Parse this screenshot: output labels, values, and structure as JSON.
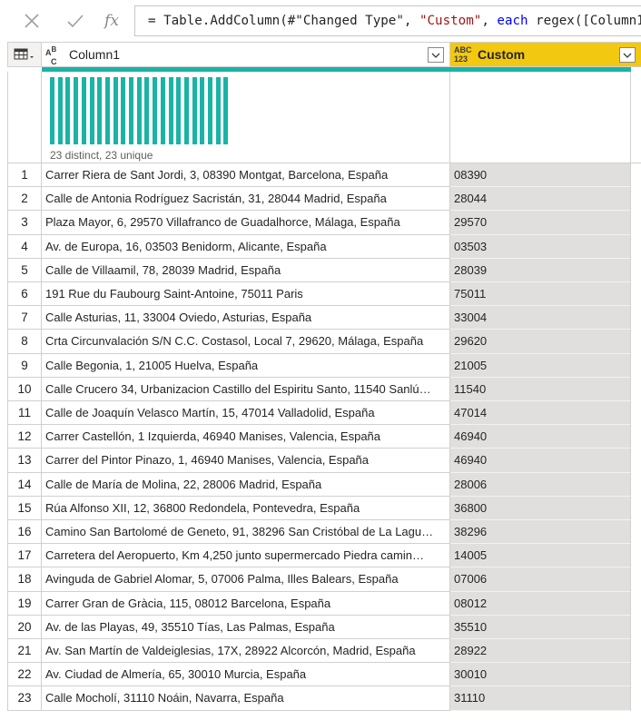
{
  "formula": {
    "cancel_icon": "close-icon",
    "accept_icon": "check-icon",
    "fx_label": "fx",
    "prefix": "= Table.AddColumn(#\"Changed Type\", ",
    "str_custom": "\"Custom\"",
    "sep": ", ",
    "kw_each": "each",
    "suffix": " regex([Column1]) "
  },
  "colors": {
    "accent_column": "#f2c811",
    "quality_bar": "#1ab3a6",
    "selected_cell": "#e1dfdd"
  },
  "columns": [
    {
      "type_top": "A",
      "type_sub": "B",
      "type_bottom": "C",
      "name": "Column1"
    },
    {
      "type_top": "ABC",
      "type_bottom": "123",
      "name": "Custom"
    }
  ],
  "profile": {
    "distinct_unique": "23 distinct, 23 unique",
    "bar_count": 23
  },
  "rows": [
    {
      "n": "1",
      "address": "Carrer Riera de Sant Jordi, 3, 08390 Montgat, Barcelona, España",
      "custom": "08390"
    },
    {
      "n": "2",
      "address": "Calle de Antonia Rodríguez Sacristán, 31, 28044 Madrid, España",
      "custom": "28044"
    },
    {
      "n": "3",
      "address": "Plaza Mayor, 6, 29570 Villafranco de Guadalhorce, Málaga, España",
      "custom": "29570"
    },
    {
      "n": "4",
      "address": "Av. de Europa, 16, 03503 Benidorm, Alicante, España",
      "custom": "03503"
    },
    {
      "n": "5",
      "address": "Calle de Villaamil, 78, 28039 Madrid, España",
      "custom": "28039"
    },
    {
      "n": "6",
      "address": "191 Rue du Faubourg Saint-Antoine, 75011 Paris",
      "custom": "75011"
    },
    {
      "n": "7",
      "address": "Calle Asturias, 11, 33004 Oviedo, Asturias, España",
      "custom": "33004"
    },
    {
      "n": "8",
      "address": "Crta Circunvalación S/N C.C. Costasol, Local 7, 29620, Málaga, España",
      "custom": "29620"
    },
    {
      "n": "9",
      "address": "Calle Begonia, 1, 21005 Huelva, España",
      "custom": "21005"
    },
    {
      "n": "10",
      "address": "Calle Crucero 34, Urbanizacion Castillo del Espiritu Santo, 11540 Sanlú…",
      "custom": "11540"
    },
    {
      "n": "11",
      "address": "Calle de Joaquín Velasco Martín, 15, 47014 Valladolid, España",
      "custom": "47014"
    },
    {
      "n": "12",
      "address": "Carrer Castellón, 1 Izquierda, 46940 Manises, Valencia, España",
      "custom": "46940"
    },
    {
      "n": "13",
      "address": "Carrer del Pintor Pinazo, 1, 46940 Manises, Valencia, España",
      "custom": "46940"
    },
    {
      "n": "14",
      "address": "Calle de María de Molina, 22, 28006 Madrid, España",
      "custom": "28006"
    },
    {
      "n": "15",
      "address": "Rúa Alfonso XII, 12, 36800 Redondela, Pontevedra, España",
      "custom": "36800"
    },
    {
      "n": "16",
      "address": "Camino San Bartolomé de Geneto, 91, 38296 San Cristóbal de La Lagu…",
      "custom": "38296"
    },
    {
      "n": "17",
      "address": "Carretera del Aeropuerto, Km 4,250 junto supermercado Piedra camin…",
      "custom": "14005"
    },
    {
      "n": "18",
      "address": "Avinguda de Gabriel Alomar, 5, 07006 Palma, Illes Balears, España",
      "custom": "07006"
    },
    {
      "n": "19",
      "address": "Carrer Gran de Gràcia, 115, 08012 Barcelona, España",
      "custom": "08012"
    },
    {
      "n": "20",
      "address": "Av. de las Playas, 49, 35510 Tías, Las Palmas, España",
      "custom": "35510"
    },
    {
      "n": "21",
      "address": "Av. San Martín de Valdeiglesias, 17X, 28922 Alcorcón, Madrid, España",
      "custom": "28922"
    },
    {
      "n": "22",
      "address": "Av. Ciudad de Almería, 65, 30010 Murcia, España",
      "custom": "30010"
    },
    {
      "n": "23",
      "address": "Calle Mocholí, 31110 Noáin, Navarra, España",
      "custom": "31110"
    }
  ]
}
